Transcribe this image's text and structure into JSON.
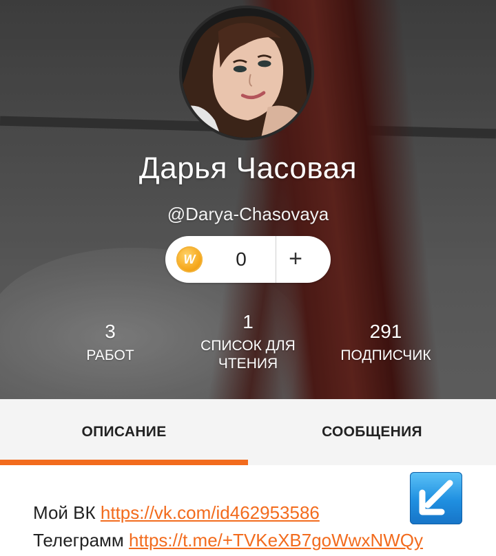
{
  "profile": {
    "name": "Дарья Часовая",
    "handle": "@Darya-Chasovaya",
    "coins": "0",
    "coin_letter": "W",
    "plus": "+"
  },
  "stats": {
    "works": {
      "value": "3",
      "label": "РАБОТ"
    },
    "reading_list": {
      "value": "1",
      "label_line1": "СПИСОК ДЛЯ",
      "label_line2": "ЧТЕНИЯ"
    },
    "followers": {
      "value": "291",
      "label": "ПОДПИСЧИК"
    }
  },
  "tabs": {
    "about": "ОПИСАНИЕ",
    "messages": "СООБЩЕНИЯ",
    "active": "about"
  },
  "description": {
    "line1_prefix": "Мой ВК",
    "line1_link": "https://vk.com/id462953586",
    "line2_prefix": "Телеграмм",
    "line2_link": "https://t.me/+TVKeXB7goWwxNWQy"
  },
  "colors": {
    "accent": "#f26b1d",
    "arrow_box": "#1f8fe0"
  },
  "icons": {
    "coin": "wattpad-coin-icon",
    "add": "plus-icon",
    "arrow": "arrow-down-left-icon"
  }
}
